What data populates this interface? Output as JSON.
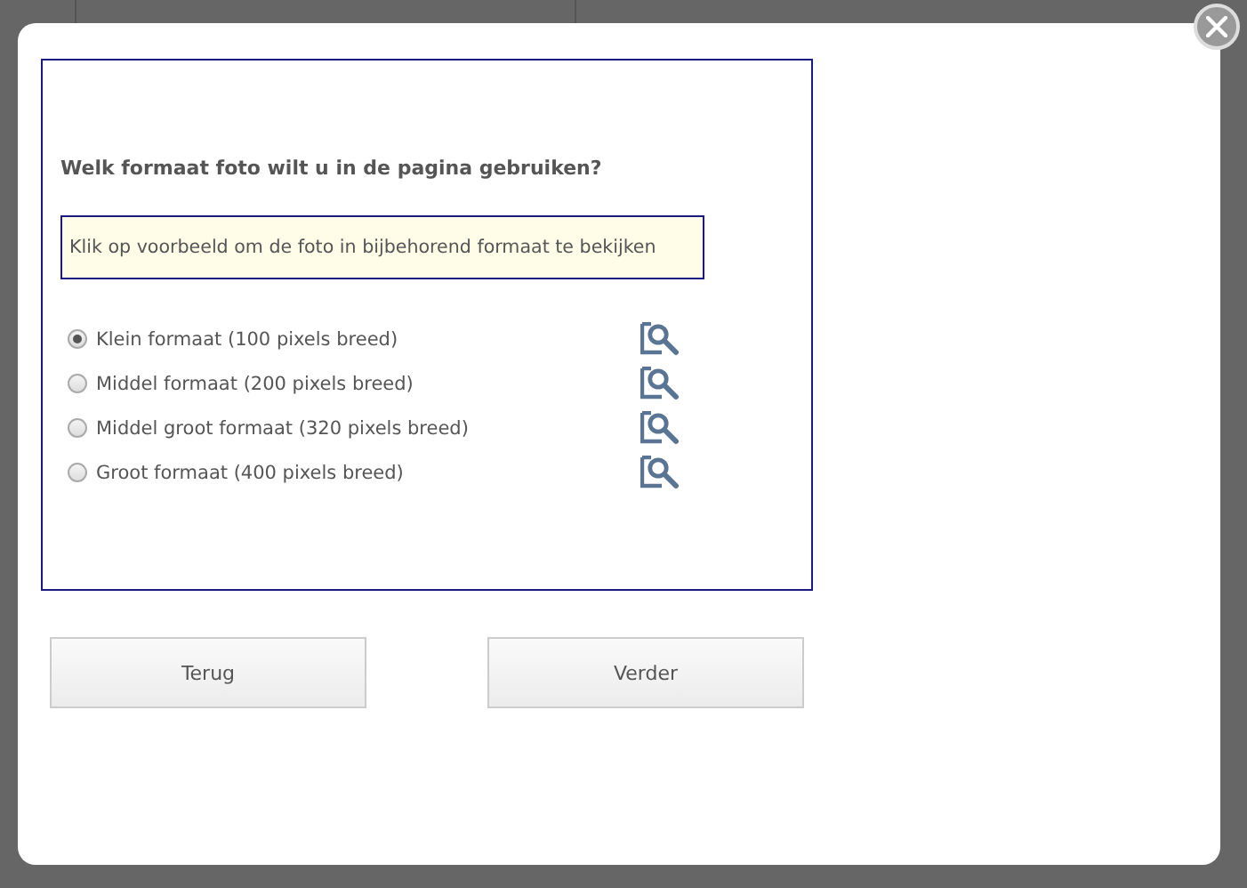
{
  "question": "Welk formaat foto wilt u in de pagina gebruiken?",
  "hint": "Klik op voorbeeld om de foto in bijbehorend formaat te bekijken",
  "options": [
    {
      "label": "Klein formaat (100 pixels breed)",
      "selected": true
    },
    {
      "label": "Middel formaat (200 pixels breed)",
      "selected": false
    },
    {
      "label": "Middel groot formaat (320 pixels breed)",
      "selected": false
    },
    {
      "label": "Groot formaat (400 pixels breed)",
      "selected": false
    }
  ],
  "buttons": [
    "Terug",
    "Verder"
  ]
}
